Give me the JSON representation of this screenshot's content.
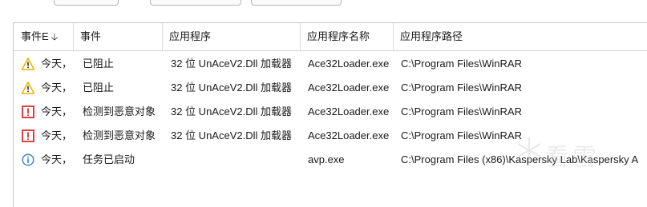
{
  "colors": {
    "warning": "#f0b400",
    "error": "#d9302e",
    "info": "#2e7fc8"
  },
  "table": {
    "columns": [
      {
        "label": "事件E",
        "sort": "descending"
      },
      {
        "label": "事件"
      },
      {
        "label": "应用程序"
      },
      {
        "label": "应用程序名称"
      },
      {
        "label": "应用程序路径"
      }
    ],
    "rows": [
      {
        "icon": "warning-icon",
        "time": "今天，",
        "event": "已阻止",
        "app": "32 位 UnAceV2.Dll 加载器",
        "name": "Ace32Loader.exe",
        "path": "C:\\Program Files\\WinRAR"
      },
      {
        "icon": "warning-icon",
        "time": "今天，",
        "event": "已阻止",
        "app": "32 位 UnAceV2.Dll 加载器",
        "name": "Ace32Loader.exe",
        "path": "C:\\Program Files\\WinRAR"
      },
      {
        "icon": "error-icon",
        "time": "今天，",
        "event": "检测到恶意对象",
        "app": "32 位 UnAceV2.Dll 加载器",
        "name": "Ace32Loader.exe",
        "path": "C:\\Program Files\\WinRAR"
      },
      {
        "icon": "error-icon",
        "time": "今天，",
        "event": "检测到恶意对象",
        "app": "32 位 UnAceV2.Dll 加载器",
        "name": "Ace32Loader.exe",
        "path": "C:\\Program Files\\WinRAR"
      },
      {
        "icon": "info-icon",
        "time": "今天，",
        "event": "任务已启动",
        "app": "",
        "name": "avp.exe",
        "path": "C:\\Program Files (x86)\\Kaspersky Lab\\Kaspersky A"
      }
    ]
  },
  "watermark": {
    "text": "看雪"
  }
}
